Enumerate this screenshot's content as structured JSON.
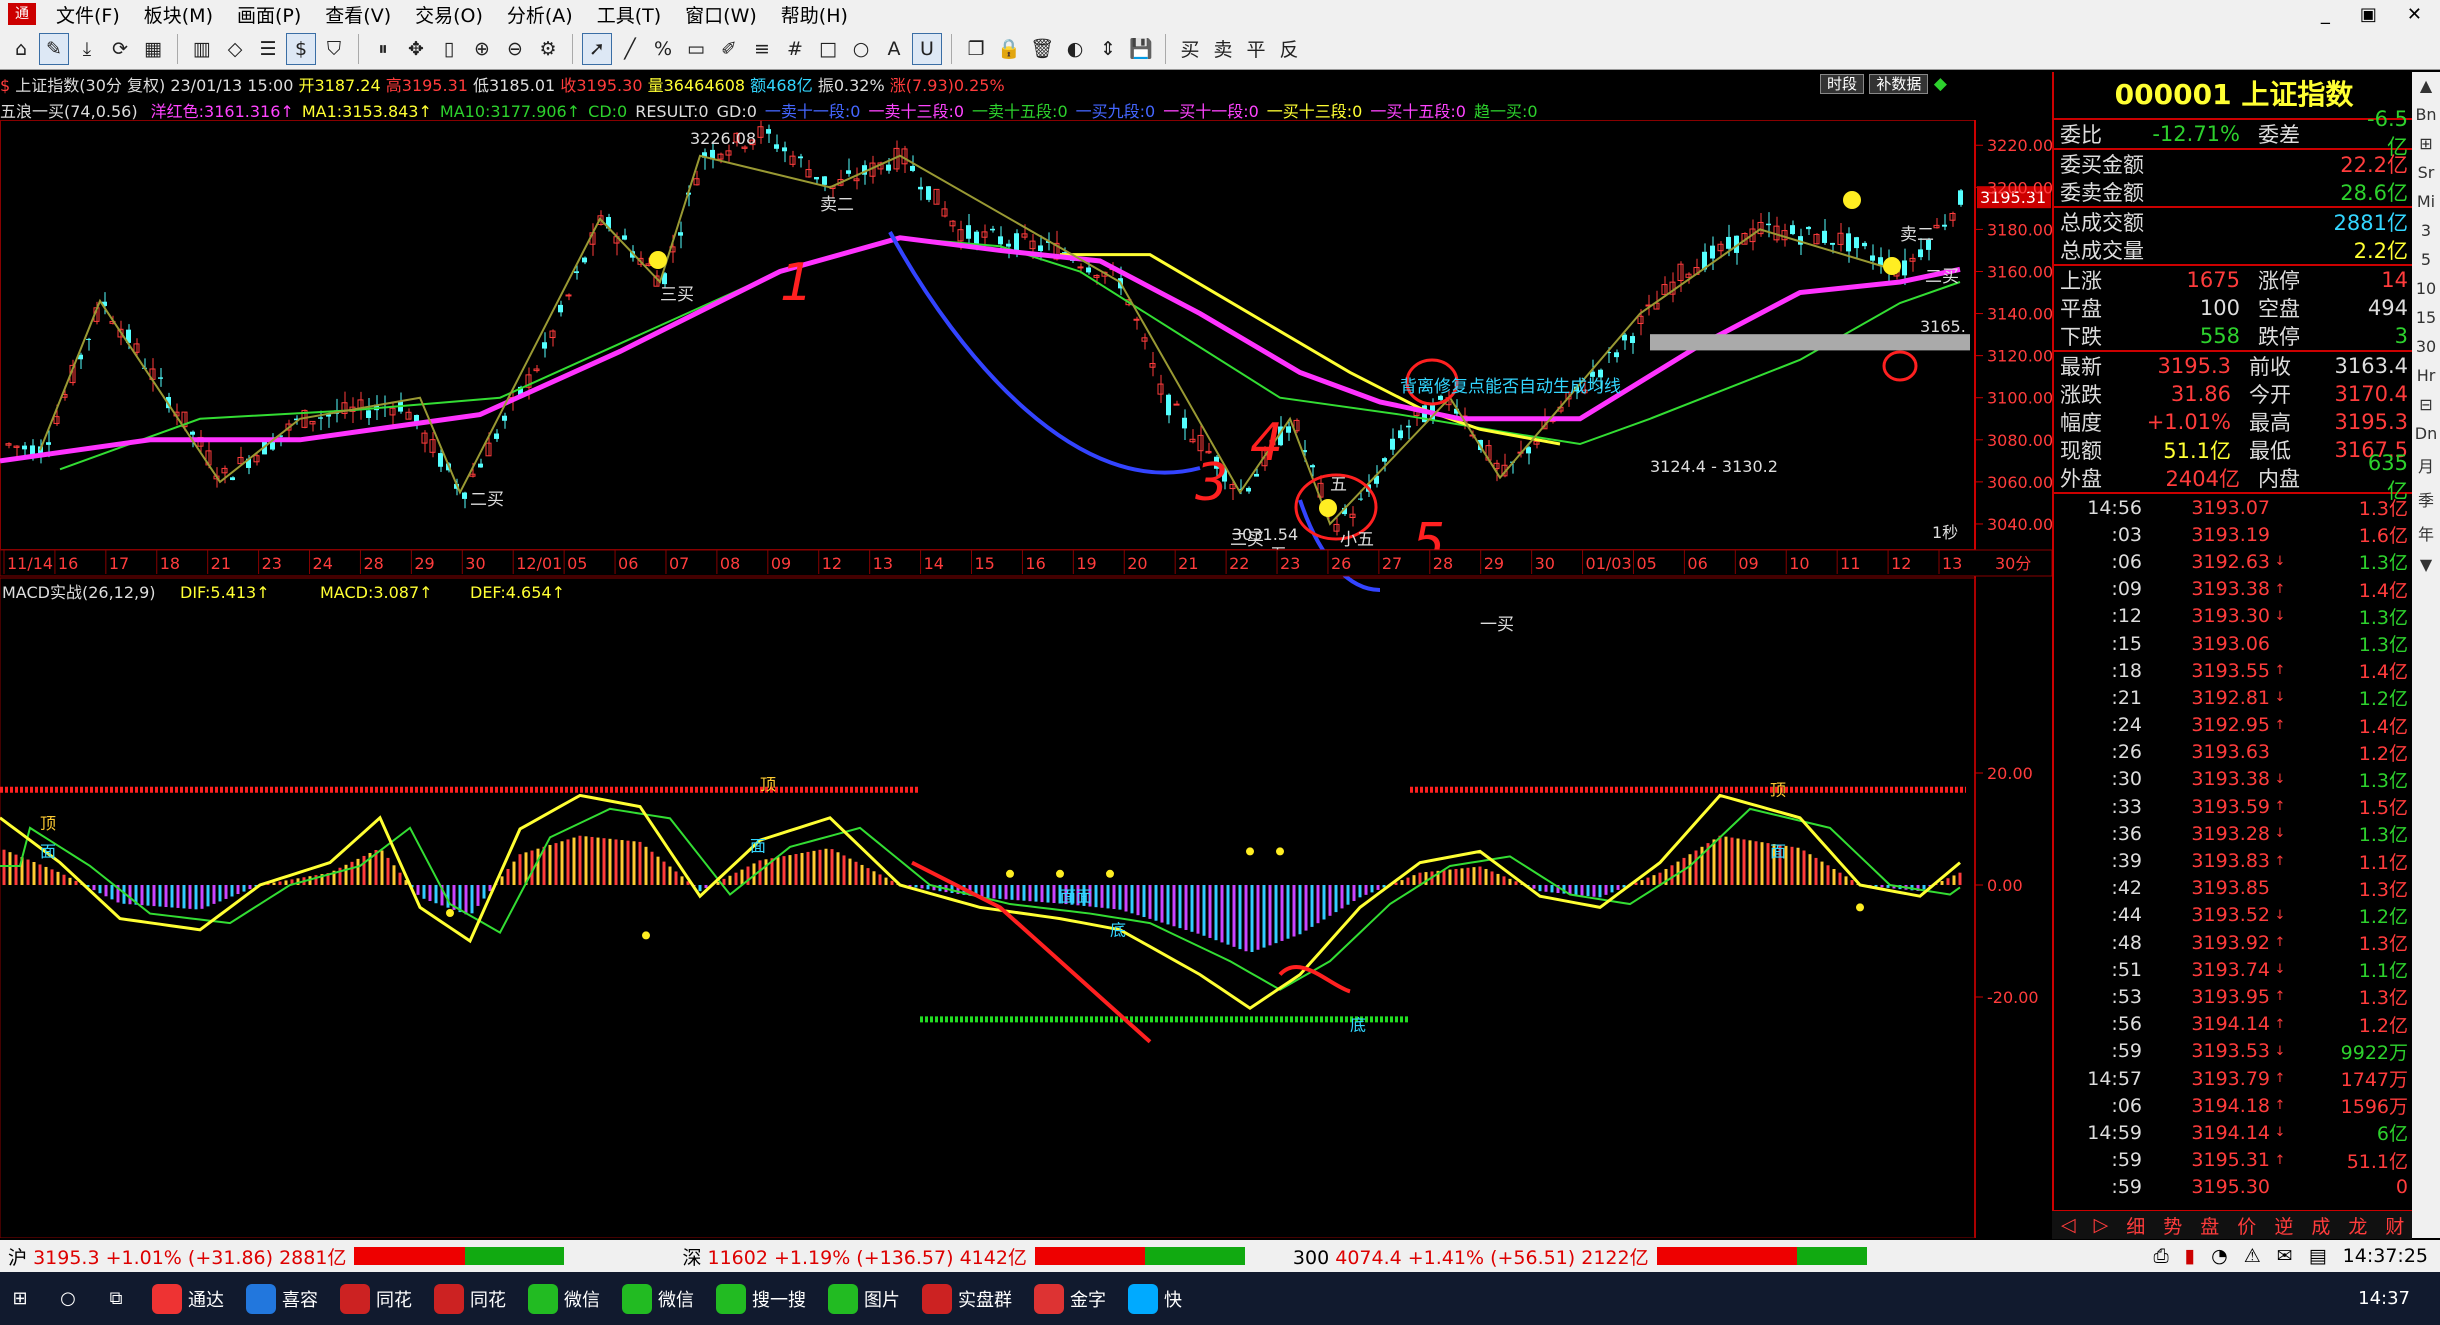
{
  "menubar": {
    "items": [
      "文件(F)",
      "板块(M)",
      "画面(P)",
      "查看(V)",
      "交易(O)",
      "分析(A)",
      "工具(T)",
      "窗口(W)",
      "帮助(H)"
    ],
    "window_buttons": [
      "_",
      "▣",
      "✕"
    ]
  },
  "toolbar": {
    "icons": [
      "home-icon",
      "draw-icon",
      "download-icon",
      "refresh-icon",
      "grid-icon",
      "candle-icon",
      "diamond-icon",
      "list-icon",
      "dollar-icon",
      "filter-icon",
      "pause-icon",
      "crosshair-icon",
      "bar-icon",
      "zoom-in-icon",
      "zoom-out-icon",
      "gear-icon",
      "pointer-icon",
      "line-icon",
      "percent-icon",
      "ruler-icon",
      "pen-icon",
      "lines-icon",
      "hash-icon",
      "rect-icon",
      "circle-icon",
      "text-icon",
      "magnet-icon",
      "copy-icon",
      "lock-icon",
      "trash-icon",
      "color-icon",
      "arrow-icon",
      "save-icon",
      "buy-icon",
      "sell-icon",
      "flat-icon",
      "reverse-icon"
    ],
    "trade_labels": [
      "买",
      "卖",
      "平",
      "反"
    ]
  },
  "chart_info": {
    "name": "上证指数(30分 复权)",
    "datetime": "23/01/13 15:00",
    "open_label": "开",
    "open": "3187.24",
    "high_label": "高",
    "high": "3195.31",
    "low_label": "低",
    "low": "3185.01",
    "close_label": "收",
    "close": "3195.30",
    "volume_label": "量",
    "volume": "36464608",
    "amount_label": "额",
    "amount": "468亿",
    "amp_label": "振",
    "amp": "0.32%",
    "chg_label": "涨",
    "chg": "(7.93)0.25%",
    "btn_time": "时段",
    "btn_fq": "补数据",
    "indicator": "五浪一买(74,0.56)",
    "ind_items": [
      {
        "t": "洋红色:3161.316↑",
        "c": "m"
      },
      {
        "t": "MA1:3153.843↑",
        "c": "y"
      },
      {
        "t": "MA10:3177.906↑",
        "c": "g"
      },
      {
        "t": "CD:0",
        "c": "g"
      },
      {
        "t": "RESULT:0",
        "c": "w"
      },
      {
        "t": "GD:0",
        "c": "w"
      },
      {
        "t": "一卖十一段:0",
        "c": "b"
      },
      {
        "t": "一卖十三段:0",
        "c": "m"
      },
      {
        "t": "一卖十五段:0",
        "c": "g"
      },
      {
        "t": "一买九段:0",
        "c": "b"
      },
      {
        "t": "一买十一段:0",
        "c": "m"
      },
      {
        "t": "一买十三段:0",
        "c": "y"
      },
      {
        "t": "一买十五段:0",
        "c": "m"
      },
      {
        "t": "趋一买:0",
        "c": "g"
      }
    ]
  },
  "main_chart": {
    "y_ticks": [
      "3220.00",
      "3200.00",
      "3180.00",
      "3160.00",
      "3140.00",
      "3120.00",
      "3100.00",
      "3080.00",
      "3060.00",
      "3040.00"
    ],
    "x_ticks": [
      "11/14",
      "16",
      "17",
      "18",
      "21",
      "23",
      "24",
      "28",
      "29",
      "30",
      "12/01",
      "05",
      "06",
      "07",
      "08",
      "09",
      "12",
      "13",
      "14",
      "15",
      "16",
      "19",
      "20",
      "21",
      "22",
      "23",
      "26",
      "27",
      "28",
      "29",
      "30",
      "01/03",
      "05",
      "06",
      "09",
      "10",
      "11",
      "12",
      "13"
    ],
    "period_label": "30分",
    "price_tag": "3195.31",
    "high_label": "3226.08",
    "low_label": "3031.54",
    "right_edge_label": "3165.",
    "zone_label": "3124.4 - 3130.2",
    "note": "背离修复点能否自动生成均线",
    "speed_label": "1秒",
    "signal_labels": [
      "二买",
      "三买",
      "三买",
      "卖二",
      "一买",
      "二买",
      "卖二",
      "五",
      "五",
      "小五",
      "卖二",
      "二买"
    ],
    "hand_numbers": [
      "1",
      "2",
      "3",
      "4",
      "5"
    ]
  },
  "macd": {
    "title": "MACD实战(26,12,9)",
    "dif": "DIF:5.413↑",
    "macd": "MACD:3.087↑",
    "dea": "DEF:4.654↑",
    "y_ticks": [
      "20.00",
      "0.00",
      "-20.00"
    ],
    "labels": [
      "顶",
      "顶",
      "面",
      "面面",
      "底",
      "底",
      "顶",
      "面",
      "面"
    ]
  },
  "quote": {
    "title": "000001 上证指数",
    "rows1": [
      {
        "l1": "委比",
        "v1": "-12.71%",
        "c1": "g",
        "l2": "委差",
        "v2": "-6.5亿",
        "c2": "g"
      }
    ],
    "rows2": [
      {
        "l": "委买金额",
        "v": "22.2亿",
        "c": "r"
      },
      {
        "l": "委卖金额",
        "v": "28.6亿",
        "c": "g"
      }
    ],
    "rows3": [
      {
        "l": "总成交额",
        "v": "2881亿",
        "c": "c"
      },
      {
        "l": "总成交量",
        "v": "2.2亿",
        "c": "y"
      }
    ],
    "rows4": [
      {
        "l1": "上涨",
        "v1": "1675",
        "c1": "r",
        "l2": "涨停",
        "v2": "14",
        "c2": "r"
      },
      {
        "l1": "平盘",
        "v1": "100",
        "c1": "w",
        "l2": "空盘",
        "v2": "494",
        "c2": "w"
      },
      {
        "l1": "下跌",
        "v1": "558",
        "c1": "g",
        "l2": "跌停",
        "v2": "3",
        "c2": "g"
      }
    ],
    "rows5": [
      {
        "l1": "最新",
        "v1": "3195.3",
        "c1": "r",
        "l2": "前收",
        "v2": "3163.4",
        "c2": "w"
      },
      {
        "l1": "涨跌",
        "v1": "31.86",
        "c1": "r",
        "l2": "今开",
        "v2": "3170.4",
        "c2": "r"
      },
      {
        "l1": "幅度",
        "v1": "+1.01%",
        "c1": "r",
        "l2": "最高",
        "v2": "3195.3",
        "c2": "r"
      },
      {
        "l1": "现额",
        "v1": "51.1亿",
        "c1": "y",
        "l2": "最低",
        "v2": "3167.5",
        "c2": "r"
      },
      {
        "l1": "外盘",
        "v1": "2404亿",
        "c1": "r",
        "l2": "内盘",
        "v2": "635亿",
        "c2": "g"
      }
    ],
    "ticks": [
      {
        "t": "14:56",
        "p": "3193.07",
        "a": "",
        "v": "1.3亿",
        "c": "r"
      },
      {
        "t": ":03",
        "p": "3193.19",
        "a": "",
        "v": "1.6亿",
        "c": "r"
      },
      {
        "t": ":06",
        "p": "3192.63",
        "a": "↓",
        "v": "1.3亿",
        "c": "g"
      },
      {
        "t": ":09",
        "p": "3193.38",
        "a": "↑",
        "v": "1.4亿",
        "c": "r"
      },
      {
        "t": ":12",
        "p": "3193.30",
        "a": "↓",
        "v": "1.3亿",
        "c": "g"
      },
      {
        "t": ":15",
        "p": "3193.06",
        "a": "",
        "v": "1.3亿",
        "c": "g"
      },
      {
        "t": ":18",
        "p": "3193.55",
        "a": "↑",
        "v": "1.4亿",
        "c": "r"
      },
      {
        "t": ":21",
        "p": "3192.81",
        "a": "↓",
        "v": "1.2亿",
        "c": "g"
      },
      {
        "t": ":24",
        "p": "3192.95",
        "a": "↑",
        "v": "1.4亿",
        "c": "r"
      },
      {
        "t": ":26",
        "p": "3193.63",
        "a": "",
        "v": "1.2亿",
        "c": "r"
      },
      {
        "t": ":30",
        "p": "3193.38",
        "a": "↓",
        "v": "1.3亿",
        "c": "g"
      },
      {
        "t": ":33",
        "p": "3193.59",
        "a": "↑",
        "v": "1.5亿",
        "c": "r"
      },
      {
        "t": ":36",
        "p": "3193.28",
        "a": "↓",
        "v": "1.3亿",
        "c": "g"
      },
      {
        "t": ":39",
        "p": "3193.83",
        "a": "↑",
        "v": "1.1亿",
        "c": "r"
      },
      {
        "t": ":42",
        "p": "3193.85",
        "a": "",
        "v": "1.3亿",
        "c": "r"
      },
      {
        "t": ":44",
        "p": "3193.52",
        "a": "↓",
        "v": "1.2亿",
        "c": "g"
      },
      {
        "t": ":48",
        "p": "3193.92",
        "a": "↑",
        "v": "1.3亿",
        "c": "r"
      },
      {
        "t": ":51",
        "p": "3193.74",
        "a": "↓",
        "v": "1.1亿",
        "c": "g"
      },
      {
        "t": ":53",
        "p": "3193.95",
        "a": "↑",
        "v": "1.3亿",
        "c": "r"
      },
      {
        "t": ":56",
        "p": "3194.14",
        "a": "↑",
        "v": "1.2亿",
        "c": "r"
      },
      {
        "t": ":59",
        "p": "3193.53",
        "a": "↓",
        "v": "9922万",
        "c": "g"
      },
      {
        "t": "14:57",
        "p": "3193.79",
        "a": "↑",
        "v": "1747万",
        "c": "r"
      },
      {
        "t": ":06",
        "p": "3194.18",
        "a": "↑",
        "v": "1596万",
        "c": "r"
      },
      {
        "t": "14:59",
        "p": "3194.14",
        "a": "↓",
        "v": "6亿",
        "c": "g"
      },
      {
        "t": ":59",
        "p": "3195.31",
        "a": "↑",
        "v": "51.1亿",
        "c": "r"
      },
      {
        "t": ":59",
        "p": "3195.30",
        "a": "",
        "v": "0",
        "c": "r"
      }
    ],
    "tabs": [
      "◁",
      "▷",
      "细",
      "势",
      "盘",
      "价",
      "逆",
      "成",
      "龙",
      "财"
    ]
  },
  "right_side": [
    "▲",
    "Bn",
    "⊞",
    "Sr",
    "Mi",
    "3",
    "5",
    "10",
    "15",
    "30",
    "Hr",
    "⊟",
    "Dn",
    "月",
    "季",
    "年",
    "▼"
  ],
  "status": {
    "sh_label": "沪",
    "sh": "3195.3 +1.01% (+31.86) 2881亿",
    "sz_label": "深",
    "sz": "11602 +1.19% (+136.57) 4142亿",
    "i300_label": "300",
    "i300": "4074.4 +1.41% (+56.51) 2122亿",
    "time": "14:37:25"
  },
  "taskbar": {
    "apps": [
      "通达",
      "喜容",
      "同花",
      "同花",
      "微信",
      "微信",
      "搜一搜",
      "图片",
      "实盘群",
      "金字",
      "快"
    ],
    "time": "14:37"
  }
}
